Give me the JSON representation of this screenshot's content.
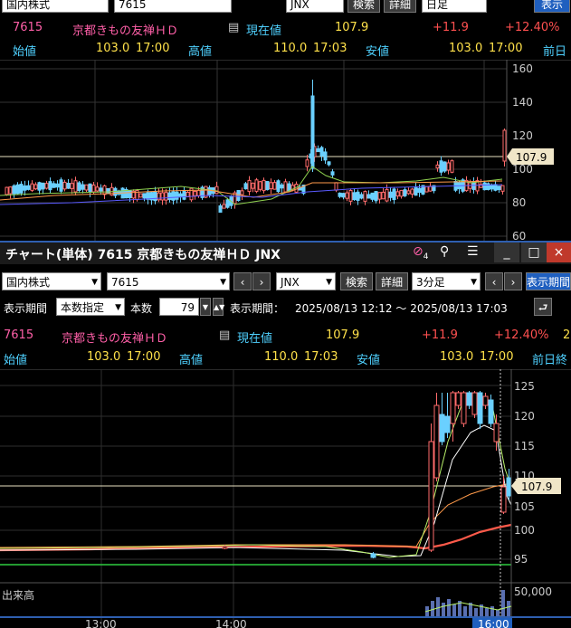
{
  "top": {
    "toolbar": {
      "market": "国内株式",
      "code": "7615",
      "exchange": "JNX",
      "search": "検索",
      "detail": "詳細",
      "period": "日足",
      "display": "表示"
    },
    "quote": {
      "code": "7615",
      "name": "京都きもの友禅ＨＤ",
      "current_label": "現在値",
      "current": "107.9",
      "change": "+11.9",
      "change_pct": "+12.40%",
      "open_label": "始値",
      "open": "103.0",
      "open_time": "17:00",
      "high_label": "高値",
      "high": "110.0",
      "high_time": "17:03",
      "low_label": "安値",
      "low": "103.0",
      "low_time": "17:00",
      "prev_label": "前日"
    },
    "price_tag": "107.9",
    "y_ticks": [
      "160",
      "140",
      "120",
      "100",
      "80",
      "60"
    ]
  },
  "window": {
    "title": "チャート(単体) 7615 京都きもの友禅ＨＤ JNX",
    "link_badge": "4",
    "minimize": "_",
    "maximize": "□",
    "close": "×"
  },
  "toolbar": {
    "market": "国内株式",
    "code": "7615",
    "exchange": "JNX",
    "search": "検索",
    "detail": "詳細",
    "period": "3分足",
    "display_period": "表示期間"
  },
  "range_bar": {
    "label": "表示期間",
    "mode": "本数指定",
    "count_label": "本数",
    "count": "79",
    "period_label": "表示期間：",
    "period_value": "2025/08/13 12:12 ～ 2025/08/13 17:03"
  },
  "quote": {
    "code": "7615",
    "name": "京都きもの友禅ＨＤ",
    "current_label": "現在値",
    "current": "107.9",
    "change": "+11.9",
    "change_pct": "+12.40%",
    "extra": "2",
    "open_label": "始値",
    "open": "103.0",
    "open_time": "17:00",
    "high_label": "高値",
    "high": "110.0",
    "high_time": "17:03",
    "low_label": "安値",
    "low": "103.0",
    "low_time": "17:00",
    "prev_label": "前日終"
  },
  "chart_data": {
    "type": "candlestick",
    "price_tag": "107.9",
    "y_ticks": [
      "125",
      "120",
      "115",
      "110",
      "105",
      "100",
      "95"
    ],
    "volume_label": "出来高",
    "volume_tick": "50,000",
    "x_ticks": [
      "13:00",
      "14:00",
      "16:00"
    ],
    "colors": {
      "up": "#ff6b6b",
      "down": "#6ad0ff",
      "ma_short": "#b8f06a",
      "ma_mid": "#ffffff",
      "ma_long": "#ff9a4a",
      "ma_base": "#ff5a4a"
    }
  }
}
